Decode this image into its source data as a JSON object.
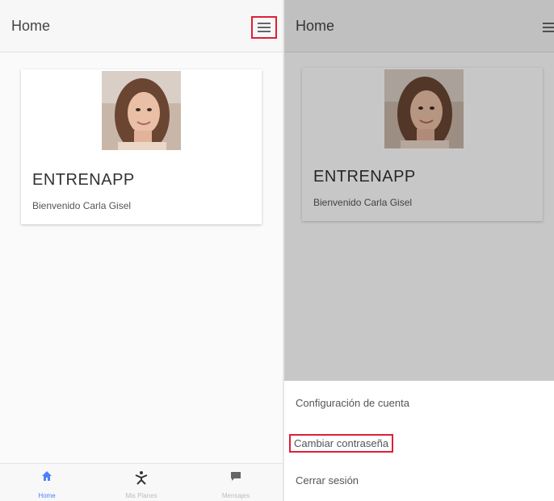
{
  "left": {
    "header": {
      "title": "Home",
      "menu_icon": "hamburger-icon"
    },
    "card": {
      "app_name": "ENTRENAPP",
      "welcome": "Bienvenido Carla Gisel"
    },
    "tabs": [
      {
        "label": "Home",
        "icon": "home-icon",
        "active": true
      },
      {
        "label": "Mis Planes",
        "icon": "workout-icon",
        "active": false
      },
      {
        "label": "Mensajes",
        "icon": "chat-icon",
        "active": false
      }
    ]
  },
  "right": {
    "header": {
      "title": "Home",
      "menu_icon": "hamburger-icon"
    },
    "card": {
      "app_name": "ENTRENAPP",
      "welcome": "Bienvenido Carla Gisel"
    },
    "menu": [
      {
        "label": "Configuración de cuenta",
        "highlighted": false
      },
      {
        "label": "Cambiar contraseña",
        "highlighted": true
      },
      {
        "label": "Cerrar sesión",
        "highlighted": false
      }
    ]
  },
  "colors": {
    "highlight": "#e01e37",
    "active_tab": "#4f7fff",
    "inactive_tab": "#bdbdbd"
  }
}
